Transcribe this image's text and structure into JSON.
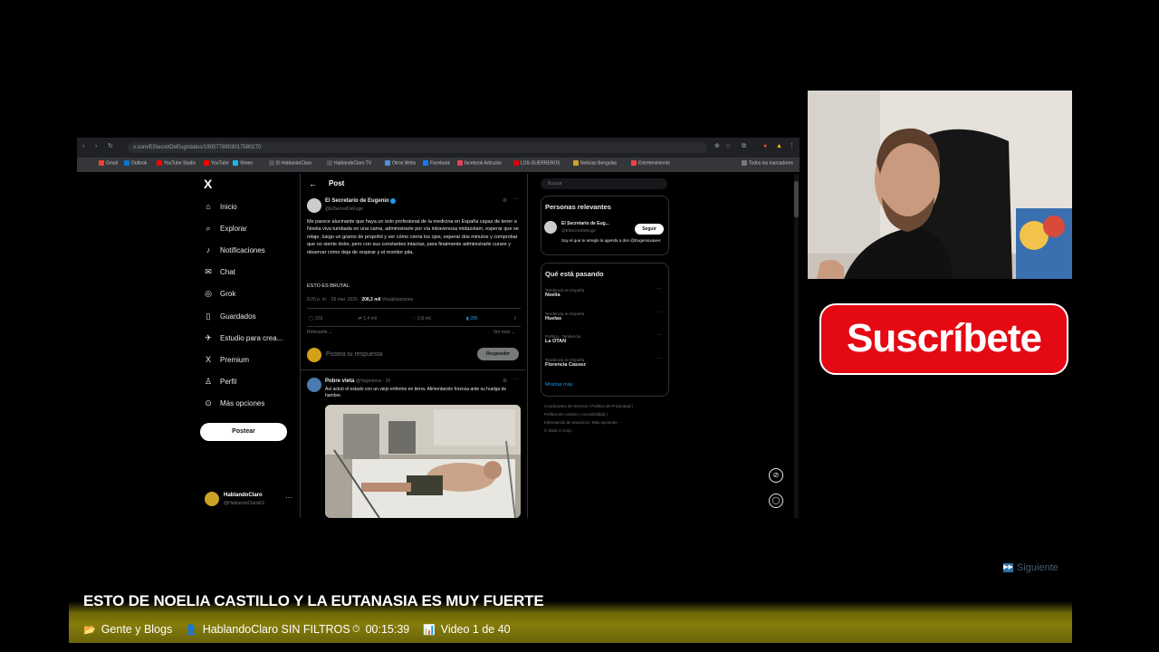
{
  "browser": {
    "url": "x.com/ElSecretDeEug/status/1905778903017580270",
    "bookmarks": [
      "Gmail",
      "Outlook",
      "YouTube Studio",
      "YouTube",
      "Vimeo",
      "El HablandoClaro",
      "HablandoClaro TV",
      "Otros Webs",
      "Facebook",
      "facebook Artículos",
      "LOS GUERREROS",
      "Noticias Bengolas",
      "Entretenimiento"
    ],
    "bookmarks_right": "Todos los marcadores"
  },
  "x_nav": {
    "logo": "X",
    "items": [
      {
        "label": "Inicio",
        "icon": "⌂"
      },
      {
        "label": "Explorar",
        "icon": "⌕"
      },
      {
        "label": "Notificaciones",
        "icon": "♪"
      },
      {
        "label": "Chat",
        "icon": "✉"
      },
      {
        "label": "Grok",
        "icon": "◎"
      },
      {
        "label": "Guardados",
        "icon": "▯"
      },
      {
        "label": "Estudio para crea...",
        "icon": "✈"
      },
      {
        "label": "Premium",
        "icon": "X"
      },
      {
        "label": "Perfil",
        "icon": "♙"
      },
      {
        "label": "Más opciones",
        "icon": "⊙"
      }
    ],
    "post_button": "Postear",
    "account_name": "HablandoClaro",
    "account_handle": "@HablandoClaroES",
    "more": "···"
  },
  "post": {
    "header": "Post",
    "author": "El Secretario de Eugenio",
    "handle": "@ElSecretDeEuge",
    "body": "Me parece alucinante que haya un solo profesional de la medicina en España capaz de tener a Noelia viva tumbada en una cama, administrarle por vía intravenosa midazolam, esperar que se relaje, luego un gramo de propofol y ver cómo cierra los ojos, esperar dos minutos y comprobar que no siente dolor, pero con sus constantes intactas, para finalmente administrarle curare y observar cómo deja de respirar y el monitor pita.",
    "body2": "ESTO ES BRUTAL.",
    "time": "8:26 p. m. · 26 mar. 2025 ·",
    "views": "208,3 mil",
    "views_label": "Visualizaciones",
    "replies": "229",
    "reposts": "1,4 mil",
    "likes": "2,8 mil",
    "bookmarks": "285",
    "relevant": "Relevante ⌄",
    "see_more": "Ver más ⌄",
    "reply_placeholder": "Postea tu respuesta",
    "reply_button": "Responder"
  },
  "reply": {
    "author": "Pobre vieta",
    "handle": "@Vegnotoss · 2h",
    "text": "Así actuó el estado con un viejo enfermo en tierra. Alimentación forzosa ante su huelga de hambre."
  },
  "right": {
    "search": "Buscar",
    "people_title": "Personas relevantes",
    "person_name": "El Secretario de Eug...",
    "person_handle": "@ElSecretDeEuge",
    "follow": "Seguir",
    "person_bio": "Soy el que te arreglo la agenda a don @Eugenioxavier.",
    "trends_title": "Qué está pasando",
    "trends": [
      {
        "ctx": "Tendencia en España",
        "topic": "Noelia"
      },
      {
        "ctx": "Tendencia en España",
        "topic": "Huelas"
      },
      {
        "ctx": "Política · Tendencia",
        "topic": "La OTAN"
      },
      {
        "ctx": "Tendencia en España",
        "topic": "Florencia Cassez"
      }
    ],
    "show_more": "Mostrar más",
    "footer": [
      "Condiciones de Servicio | Política de Privacidad |",
      "Política de cookies | Accesibilidad |",
      "Información de anuncios | Más opciones ···",
      "© 2025 X Corp."
    ]
  },
  "overlay": {
    "subscribe": "Suscríbete",
    "next": "Siguiente",
    "video_title": "ESTO DE NOELIA CASTILLO Y LA EUTANASIA ES MUY FUERTE",
    "category": "Gente y Blogs",
    "channel": "HablandoClaro SIN FILTROS",
    "duration": "00:15:39",
    "playlist": "Video 1 de 40"
  }
}
